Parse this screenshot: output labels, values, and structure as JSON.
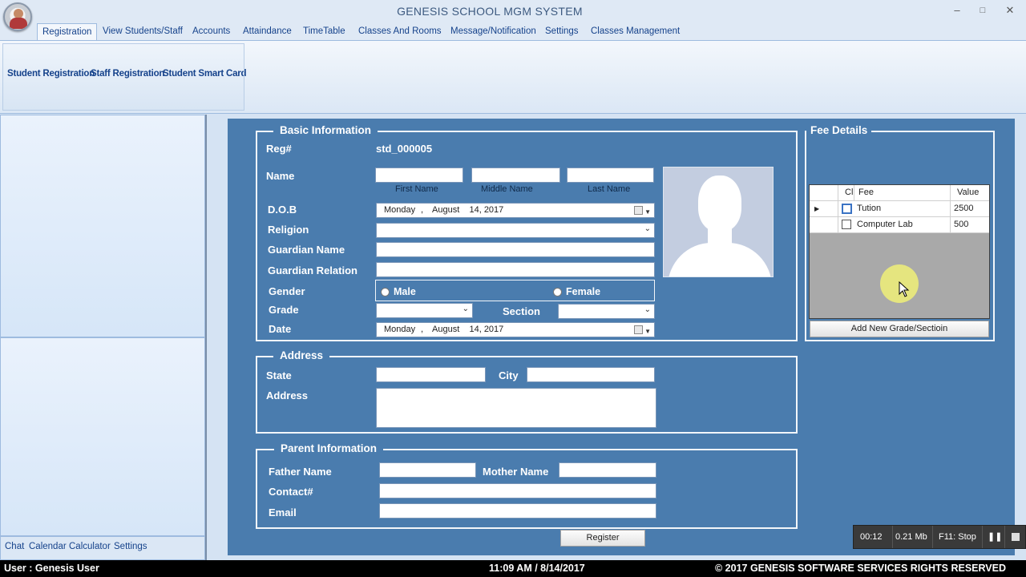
{
  "window": {
    "title": "GENESIS SCHOOL MGM SYSTEM",
    "minimize": "–",
    "maximize": "□",
    "close": "✕"
  },
  "ribbon": {
    "tabs": [
      "Registration",
      "View Students/Staff",
      "Accounts",
      "Attaindance",
      "TimeTable",
      "Classes And Rooms",
      "Message/Notification",
      "Settings",
      "Classes Management"
    ],
    "active_tab": "Registration",
    "buttons": [
      "Student Registration",
      "Staff Registration",
      "Student Smart Card"
    ]
  },
  "left_links": [
    "Chat",
    "Calendar",
    "Calculator",
    "Settings"
  ],
  "basic_info": {
    "title": "Basic Information",
    "reg_label": "Reg#",
    "reg_value": "std_000005",
    "name_label": "Name",
    "first_name": "First Name",
    "middle_name": "Middle Name",
    "last_name": "Last Name",
    "dob_label": "D.O.B",
    "dob_day": "Monday",
    "dob_sep": ",",
    "dob_date": "August    14, 2017",
    "religion_label": "Religion",
    "guardian_name_label": "Guardian Name",
    "guardian_relation_label": "Guardian Relation",
    "gender_label": "Gender",
    "male": "Male",
    "female": "Female",
    "grade_label": "Grade",
    "section_label": "Section",
    "date_label": "Date",
    "date_day": "Monday",
    "date_sep": ",",
    "date_date": "August    14, 2017"
  },
  "address": {
    "title": "Address",
    "state_label": "State",
    "city_label": "City",
    "address_label": "Address"
  },
  "parent": {
    "title": "Parent Information",
    "father_label": "Father Name",
    "mother_label": "Mother Name",
    "contact_label": "Contact#",
    "email_label": "Email"
  },
  "register_button": "Register",
  "fee_details": {
    "title": "Fee Details",
    "columns": [
      "Cl",
      "Fee",
      "Value"
    ],
    "rows": [
      {
        "fee": "Tution",
        "value": "2500",
        "checked": false
      },
      {
        "fee": "Computer Lab",
        "value": "500",
        "checked": false
      }
    ],
    "add_button": "Add New Grade/Sectioin"
  },
  "status_bar": {
    "user": "User : Genesis User",
    "datetime": "11:09 AM / 8/14/2017",
    "copyright": "© 2017 GENESIS SOFTWARE SERVICES RIGHTS RESERVED"
  },
  "recorder": {
    "time": "00:12",
    "size": "0.21 Mb",
    "stop": "F11: Stop"
  }
}
